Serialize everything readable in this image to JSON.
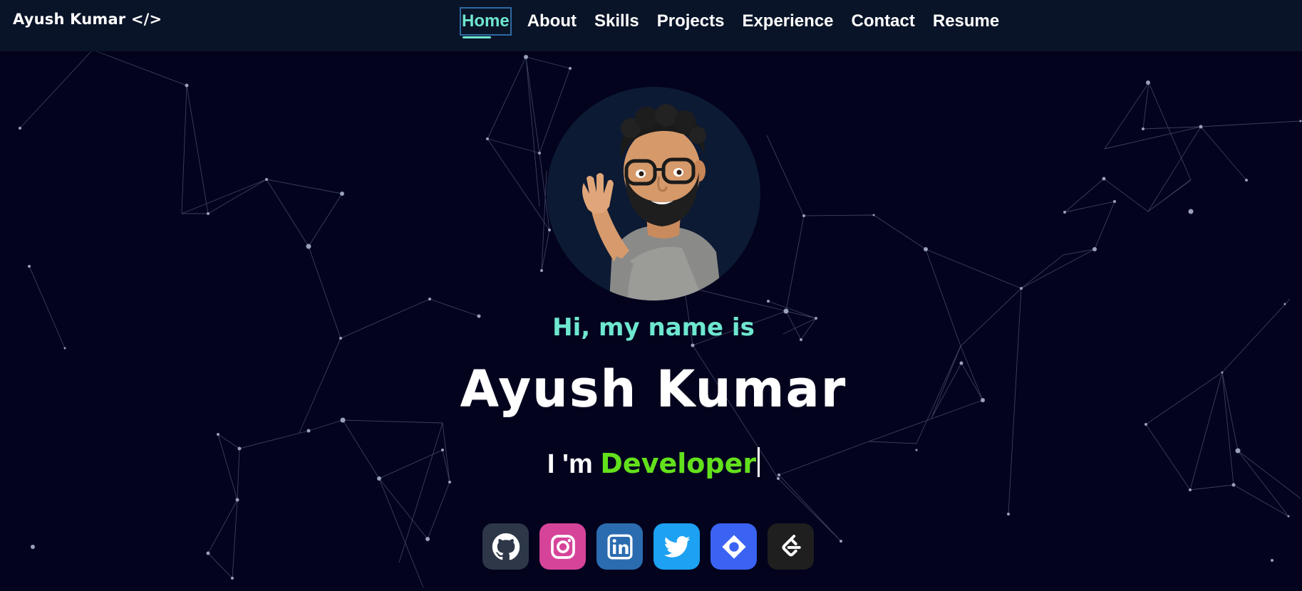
{
  "brand": "Ayush Kumar </>",
  "nav": {
    "links": [
      {
        "label": "Home",
        "active": true
      },
      {
        "label": "About"
      },
      {
        "label": "Skills"
      },
      {
        "label": "Projects"
      },
      {
        "label": "Experience"
      },
      {
        "label": "Contact"
      },
      {
        "label": "Resume"
      }
    ]
  },
  "hero": {
    "greeting": "Hi, my name is",
    "name": "Ayush Kumar",
    "role_prefix": "I 'm",
    "role_word": "Developer",
    "avatar": "waving-memoji-avatar"
  },
  "socials": [
    {
      "name": "github",
      "icon": "github-icon",
      "color": "#2d3748"
    },
    {
      "name": "instagram",
      "icon": "instagram-icon",
      "color": "#d6449a"
    },
    {
      "name": "linkedin",
      "icon": "linkedin-icon",
      "color": "#2b6cb0"
    },
    {
      "name": "twitter",
      "icon": "twitter-icon",
      "color": "#1da1f2"
    },
    {
      "name": "quira",
      "icon": "quira-icon",
      "color": "#3b63f3"
    },
    {
      "name": "leetcode",
      "icon": "leetcode-icon",
      "color": "#1f1f1f"
    }
  ],
  "colors": {
    "background": "#03031e",
    "navbar": "#0a1428",
    "accent": "#6ee7cf",
    "role_highlight": "#63e01c"
  }
}
